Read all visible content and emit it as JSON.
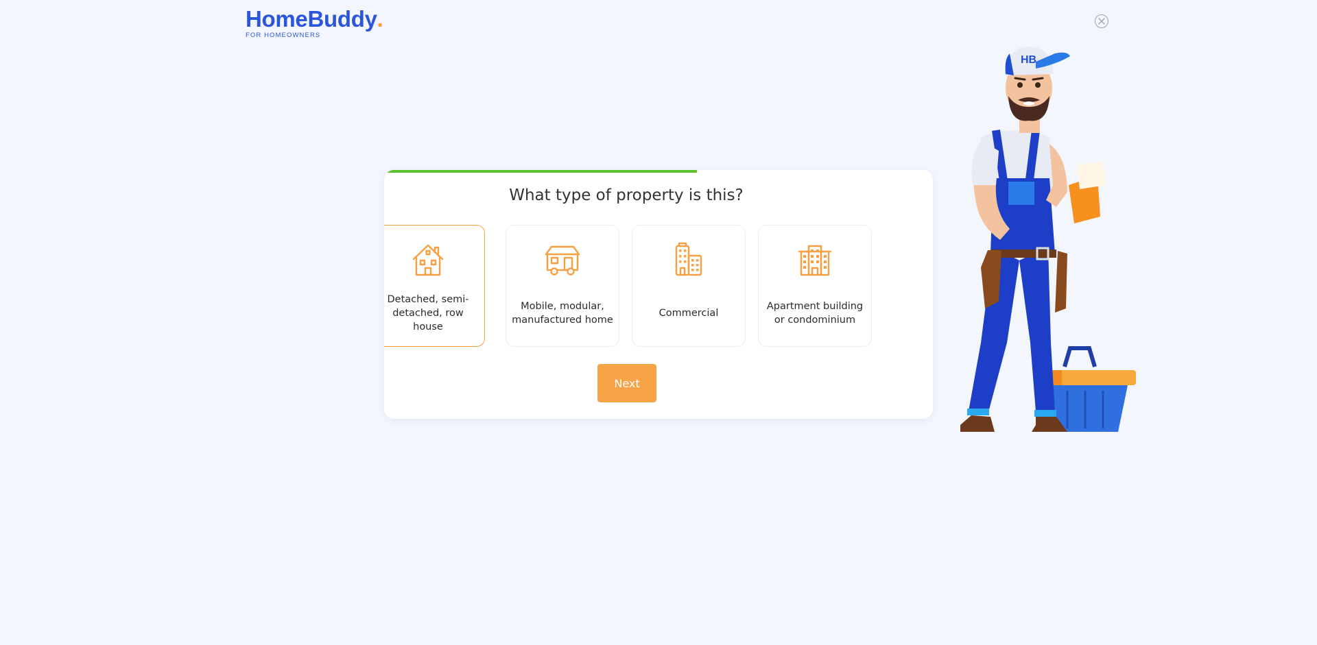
{
  "header": {
    "brand_name": "HomeBuddy",
    "brand_dot": ".",
    "brand_tagline": "FOR HOMEOWNERS",
    "close_icon": "close-icon"
  },
  "progress": {
    "fraction": 0.57,
    "color": "#5cc12e"
  },
  "question": {
    "title": "What type of property is this?"
  },
  "options": [
    {
      "label": "Detached, semi-detached, row house",
      "icon": "house-icon",
      "selected": true
    },
    {
      "label": "Mobile, modular, manufactured home",
      "icon": "mobile-home-icon",
      "selected": false
    },
    {
      "label": "Commercial",
      "icon": "commercial-building-icon",
      "selected": false
    },
    {
      "label": "Apartment building or condominium",
      "icon": "apartment-building-icon",
      "selected": false
    }
  ],
  "actions": {
    "next_label": "Next"
  },
  "mascot": {
    "cap_text": "HB"
  },
  "colors": {
    "brand_blue": "#2b56d9",
    "accent_orange": "#f6a042",
    "background": "#f4f6fd"
  }
}
